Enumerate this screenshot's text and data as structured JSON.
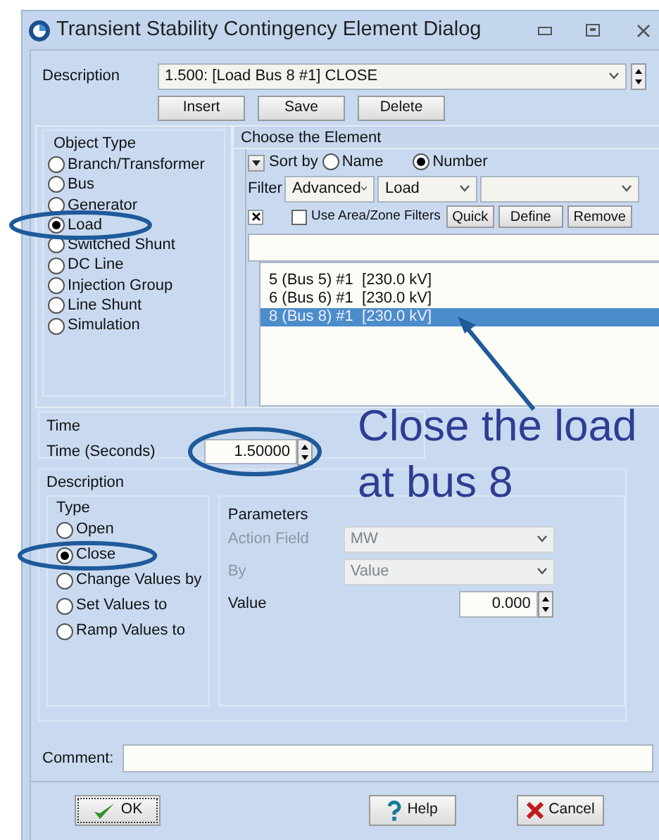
{
  "window": {
    "title": "Transient Stability Contingency Element Dialog"
  },
  "description": {
    "label": "Description",
    "value": "1.500: [Load Bus 8 #1] CLOSE"
  },
  "record_buttons": [
    "Insert",
    "Save",
    "Delete"
  ],
  "object_type": {
    "title": "Object Type",
    "options": [
      {
        "label": "Branch/Transformer",
        "selected": false
      },
      {
        "label": "Bus",
        "selected": false
      },
      {
        "label": "Generator",
        "selected": false
      },
      {
        "label": "Load",
        "selected": true
      },
      {
        "label": "Switched Shunt",
        "selected": false
      },
      {
        "label": "DC Line",
        "selected": false
      },
      {
        "label": "Injection Group",
        "selected": false
      },
      {
        "label": "Line Shunt",
        "selected": false
      },
      {
        "label": "Simulation",
        "selected": false
      }
    ]
  },
  "chooser": {
    "title": "Choose the Element",
    "sort_label": "Sort by",
    "sort_options": [
      {
        "label": "Name",
        "selected": false
      },
      {
        "label": "Number",
        "selected": true
      }
    ],
    "filter_label": "Filter",
    "filter_values": [
      "Advanced",
      "Load"
    ],
    "use_area_zone": {
      "label": "Use Area/Zone Filters",
      "checked": false
    },
    "filter_buttons": [
      "Quick",
      "Define",
      "Remove"
    ],
    "elements": [
      {
        "text": "5 (Bus 5) #1  [230.0 kV]",
        "selected": false
      },
      {
        "text": "6 (Bus 6) #1  [230.0 kV]",
        "selected": false
      },
      {
        "text": "8 (Bus 8) #1  [230.0 kV]",
        "selected": true
      }
    ]
  },
  "time": {
    "title": "Time",
    "label": "Time (Seconds)",
    "value": "1.50000"
  },
  "action": {
    "title": "Description",
    "type_title": "Type",
    "types": [
      {
        "label": "Open",
        "selected": false
      },
      {
        "label": "Close",
        "selected": true
      },
      {
        "label": "Change Values by",
        "selected": false
      },
      {
        "label": "Set Values to",
        "selected": false
      },
      {
        "label": "Ramp Values to",
        "selected": false
      }
    ],
    "parameters_title": "Parameters",
    "parameters": [
      {
        "kind": "select",
        "label": "Action Field",
        "value": "MW",
        "disabled": true
      },
      {
        "kind": "select",
        "label": "By",
        "value": "Value",
        "disabled": true
      },
      {
        "kind": "number",
        "label": "Value",
        "value": "0.000",
        "disabled": false
      }
    ]
  },
  "comment": {
    "label": "Comment:"
  },
  "footer_buttons": [
    {
      "kind": "ok",
      "label": "OK"
    },
    {
      "kind": "help",
      "label": "Help"
    },
    {
      "kind": "cancel",
      "label": "Cancel"
    }
  ],
  "annotation": {
    "text": "Close the load at bus 8"
  }
}
